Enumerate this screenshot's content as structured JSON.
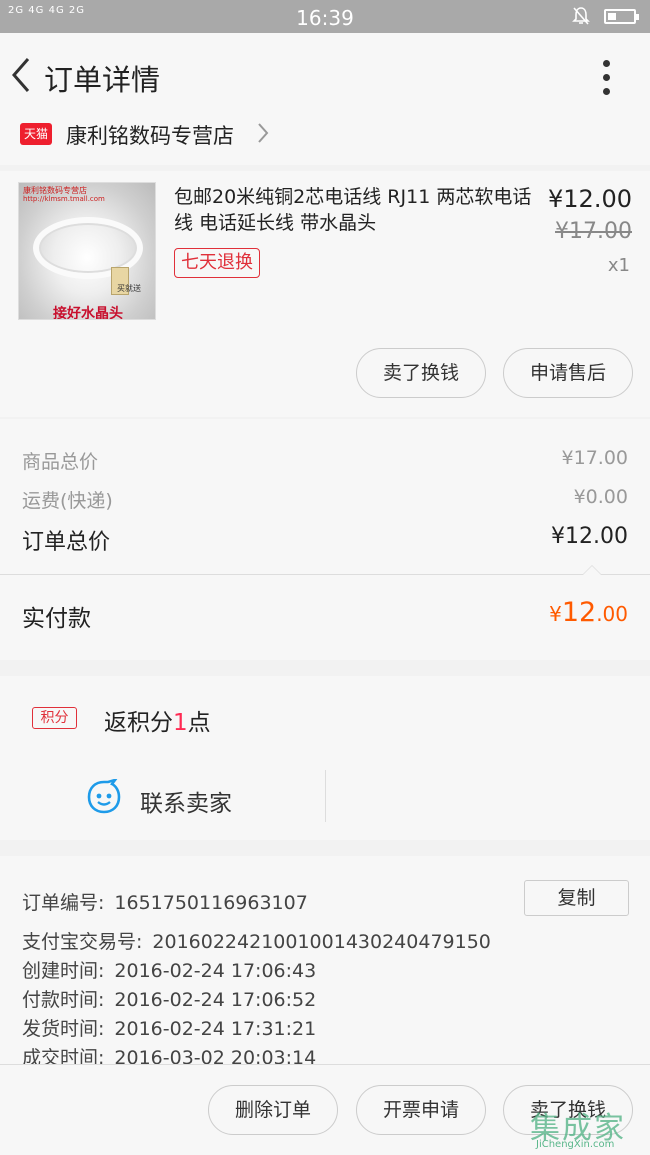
{
  "status_bar": {
    "signal": "2G 4G 4G 2G",
    "time": "16:39",
    "battery_level": 0.35
  },
  "header": {
    "title": "订单详情"
  },
  "store": {
    "badge": "天猫",
    "name": "康利铭数码专营店"
  },
  "product": {
    "image_text": {
      "top": "康利铭数码专营店",
      "url": "http://klmsm.tmall.com",
      "gift": "买就送",
      "caption": "接好水晶头"
    },
    "title": "包邮20米纯铜2芯电话线 RJ11 两芯软电话线 电话延长线 带水晶头",
    "badge": "七天退换",
    "price": "¥12.00",
    "original_price": "¥17.00",
    "quantity": "x1",
    "buttons": [
      "卖了换钱",
      "申请售后"
    ]
  },
  "summary": {
    "goods_total_label": "商品总价",
    "goods_total": "¥17.00",
    "shipping_label": "运费(快递)",
    "shipping": "¥0.00",
    "order_total_label": "订单总价",
    "order_total": "¥12.00",
    "paid_label": "实付款",
    "paid_currency": "¥",
    "paid_integer": "12",
    "paid_decimal": ".00"
  },
  "points": {
    "badge": "积分",
    "text_prefix": "返积分",
    "number": "1",
    "text_suffix": "点"
  },
  "contact": {
    "label": "联系卖家"
  },
  "order_info": {
    "order_no_label": "订单编号:",
    "order_no": "1651750116963107",
    "copy_label": "复制",
    "alipay_label": "支付宝交易号:",
    "alipay_no": "2016022421001001430240479150",
    "created_label": "创建时间:",
    "created": "2016-02-24 17:06:43",
    "paid_label": "付款时间:",
    "paid": "2016-02-24 17:06:52",
    "shipped_label": "发货时间:",
    "shipped": "2016-02-24 17:31:21",
    "done_label": "成交时间:",
    "done": "2016-03-02 20:03:14"
  },
  "bottom_bar": {
    "buttons": [
      "删除订单",
      "开票申请",
      "卖了换钱"
    ]
  },
  "watermark": {
    "text": "集成家",
    "url": "JiChengXin.com"
  },
  "colors": {
    "accent_orange": "#ff5a00",
    "tmall_red": "#ee1f2e",
    "badge_red": "#e0303a",
    "contact_blue": "#1e9be9"
  }
}
